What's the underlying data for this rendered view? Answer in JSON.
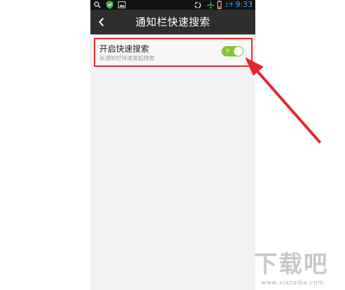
{
  "status_bar": {
    "ampm": "上午",
    "time": "9:33",
    "icons": [
      "search-icon",
      "shield-icon",
      "image-icon",
      "sync-icon",
      "airplane-icon",
      "battery-icon"
    ]
  },
  "header": {
    "title": "通知栏快速搜索",
    "back_icon": "chevron-left-icon"
  },
  "settings": [
    {
      "title": "开启快速搜索",
      "subtitle": "从通知栏快速发起搜索",
      "toggle_label": "开",
      "enabled": true
    }
  ],
  "colors": {
    "status_bar": "#111111",
    "title_bar": "#2e2e2e",
    "page_bg": "#f2f2f2",
    "toggle_on": "#7fc535",
    "annotation_red": "#e8262a",
    "time_blue": "#55a8ff"
  },
  "watermark": {
    "logo": "下载吧",
    "url": "www.xiazaiba.com"
  }
}
